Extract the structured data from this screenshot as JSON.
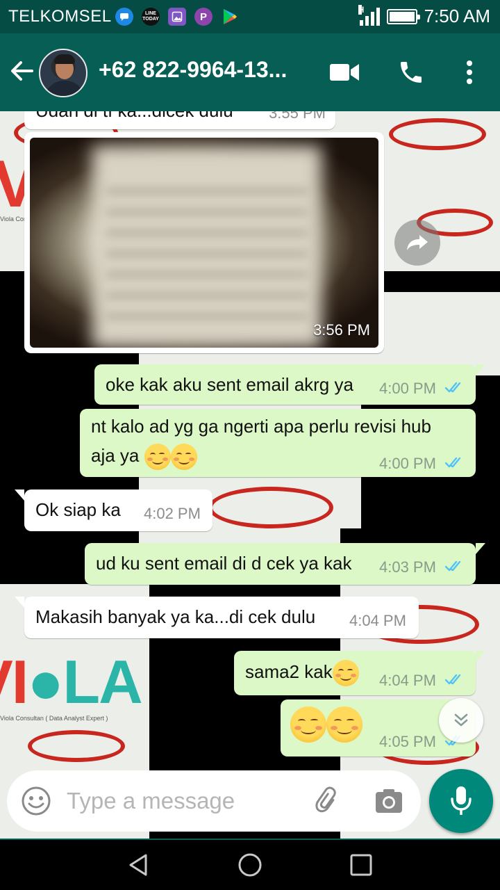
{
  "status_bar": {
    "carrier": "TELKOMSEL",
    "time": "7:50 AM",
    "network_type": "H",
    "notification_icons": [
      "message-icon",
      "line-today-icon",
      "gallery-icon",
      "p-app-icon",
      "play-store-icon"
    ],
    "line_today_label": "LINE TODAY",
    "p_app_label": "P"
  },
  "header": {
    "contact_name": "+62 822-9964-13...",
    "icons": [
      "back-arrow-icon",
      "video-call-icon",
      "phone-call-icon",
      "more-options-icon"
    ]
  },
  "messages": [
    {
      "id": 1,
      "direction": "in",
      "text": "Udah di tf ka...dicek dulu",
      "time": "3:55 PM"
    },
    {
      "id": 2,
      "direction": "in",
      "type": "image",
      "time": "3:56 PM"
    },
    {
      "id": 3,
      "direction": "out",
      "text": "oke kak aku sent email akrg ya",
      "time": "4:00 PM",
      "status": "read"
    },
    {
      "id": 4,
      "direction": "out",
      "text_line1": "nt kalo ad yg ga ngerti apa perlu revisi hub",
      "text_line2": "aja ya",
      "emojis": 2,
      "time": "4:00 PM",
      "status": "read"
    },
    {
      "id": 5,
      "direction": "in",
      "text": "Ok siap ka",
      "time": "4:02 PM"
    },
    {
      "id": 6,
      "direction": "out",
      "text": "ud ku sent email di d cek ya kak",
      "time": "4:03 PM",
      "status": "read"
    },
    {
      "id": 7,
      "direction": "in",
      "text": "Makasih banyak ya ka...di cek dulu",
      "time": "4:04 PM"
    },
    {
      "id": 8,
      "direction": "out",
      "text": "sama2 kak",
      "emojis": 1,
      "time": "4:04 PM",
      "status": "read"
    },
    {
      "id": 9,
      "direction": "out",
      "emojis": 2,
      "time": "4:05 PM",
      "status": "read"
    }
  ],
  "wallpaper": {
    "logo_text_red": "VI",
    "logo_text_teal": "LA",
    "logo_tagline": "Viola Consultan ( Data Analyst Expert )"
  },
  "composer": {
    "placeholder": "Type a message",
    "icons": [
      "emoji-icon",
      "attach-icon",
      "camera-icon",
      "mic-icon"
    ]
  },
  "colors": {
    "header_bg": "#075e54",
    "status_bg": "#054d44",
    "outgoing_bubble": "#dcf8c6",
    "incoming_bubble": "#ffffff",
    "read_ticks": "#4fc3f7",
    "mic_button": "#00897b"
  }
}
